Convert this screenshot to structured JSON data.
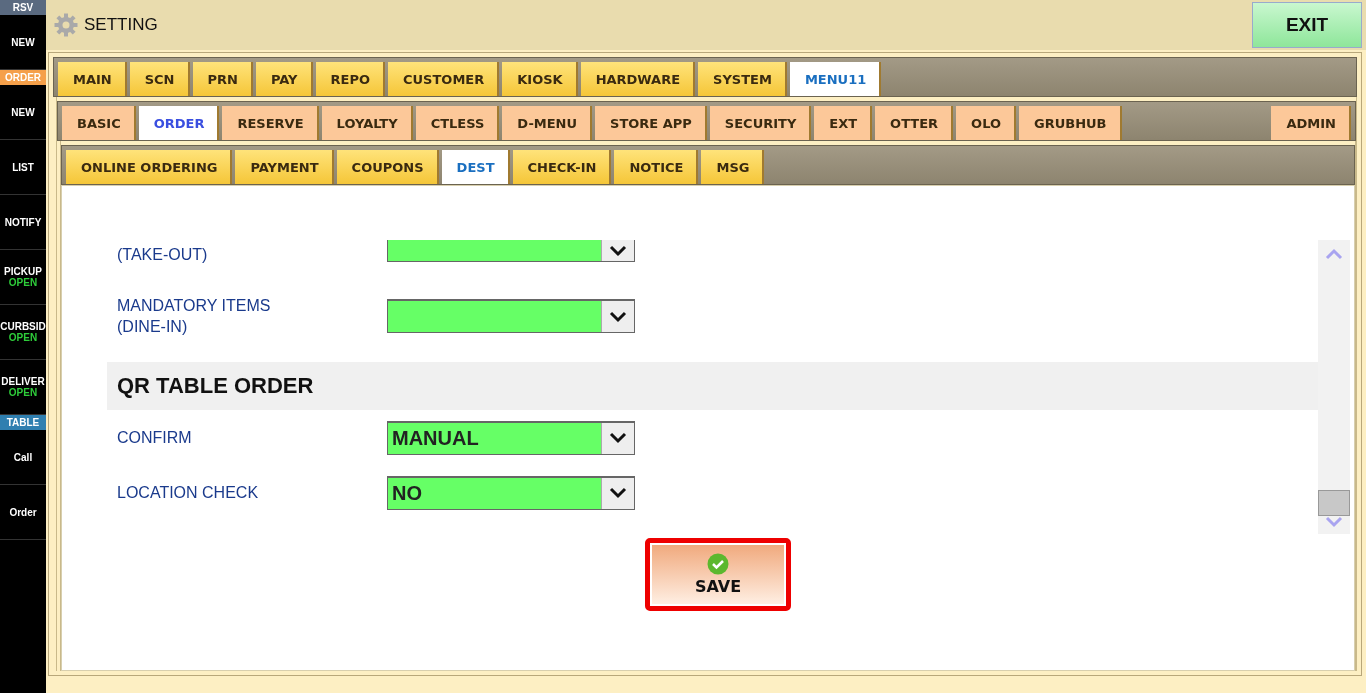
{
  "sidebar": [
    {
      "kind": "header",
      "label": "RSV",
      "color": "#5a6a80"
    },
    {
      "kind": "item",
      "label": "NEW"
    },
    {
      "kind": "header",
      "label": "ORDER",
      "color": "#f5a04a"
    },
    {
      "kind": "item",
      "label": "NEW"
    },
    {
      "kind": "item",
      "label": "LIST"
    },
    {
      "kind": "item",
      "label": "NOTIFY"
    },
    {
      "kind": "item",
      "label": "PICKUP",
      "status": "OPEN"
    },
    {
      "kind": "item",
      "label": "CURBSID",
      "status": "OPEN"
    },
    {
      "kind": "item",
      "label": "DELIVER",
      "status": "OPEN"
    },
    {
      "kind": "header",
      "label": "TABLE",
      "color": "#2f7fb0"
    },
    {
      "kind": "item",
      "label": "Call"
    },
    {
      "kind": "item",
      "label": "Order"
    }
  ],
  "window": {
    "title": "SETTING",
    "exit": "EXIT"
  },
  "tabs": [
    {
      "label": "MAIN",
      "selected": false
    },
    {
      "label": "SCN",
      "selected": false
    },
    {
      "label": "PRN",
      "selected": false
    },
    {
      "label": "PAY",
      "selected": false
    },
    {
      "label": "REPO",
      "selected": false
    },
    {
      "label": "CUSTOMER",
      "selected": false
    },
    {
      "label": "KIOSK",
      "selected": false
    },
    {
      "label": "HARDWARE",
      "selected": false
    },
    {
      "label": "SYSTEM",
      "selected": false
    },
    {
      "label": "MENU11",
      "selected": true
    }
  ],
  "subtabs": {
    "left": [
      {
        "label": "BASIC",
        "selected": false
      },
      {
        "label": "ORDER",
        "selected": true
      },
      {
        "label": "RESERVE",
        "selected": false
      },
      {
        "label": "LOYALTY",
        "selected": false
      },
      {
        "label": "CTLESS",
        "selected": false
      },
      {
        "label": "D-MENU",
        "selected": false
      },
      {
        "label": "STORE APP",
        "selected": false
      },
      {
        "label": "SECURITY",
        "selected": false
      },
      {
        "label": "EXT",
        "selected": false
      },
      {
        "label": "OTTER",
        "selected": false
      },
      {
        "label": "OLO",
        "selected": false
      },
      {
        "label": "GRUBHUB",
        "selected": false
      }
    ],
    "right": [
      {
        "label": "ADMIN",
        "selected": false
      }
    ]
  },
  "pagetabs": [
    {
      "label": "ONLINE ORDERING",
      "selected": false
    },
    {
      "label": "PAYMENT",
      "selected": false
    },
    {
      "label": "COUPONS",
      "selected": false
    },
    {
      "label": "DEST",
      "selected": true
    },
    {
      "label": "CHECK-IN",
      "selected": false
    },
    {
      "label": "NOTICE",
      "selected": false
    },
    {
      "label": "MSG",
      "selected": false
    }
  ],
  "form": [
    {
      "kind": "clipped",
      "label": "(TAKE-OUT)"
    },
    {
      "kind": "field",
      "label": "MANDATORY ITEMS\n(DINE-IN)"
    },
    {
      "kind": "section",
      "label": "QR TABLE ORDER"
    },
    {
      "kind": "field",
      "label": "CONFIRM",
      "value": "MANUAL"
    },
    {
      "kind": "field",
      "label": "LOCATION CHECK",
      "value": "NO"
    }
  ],
  "save": "SAVE"
}
